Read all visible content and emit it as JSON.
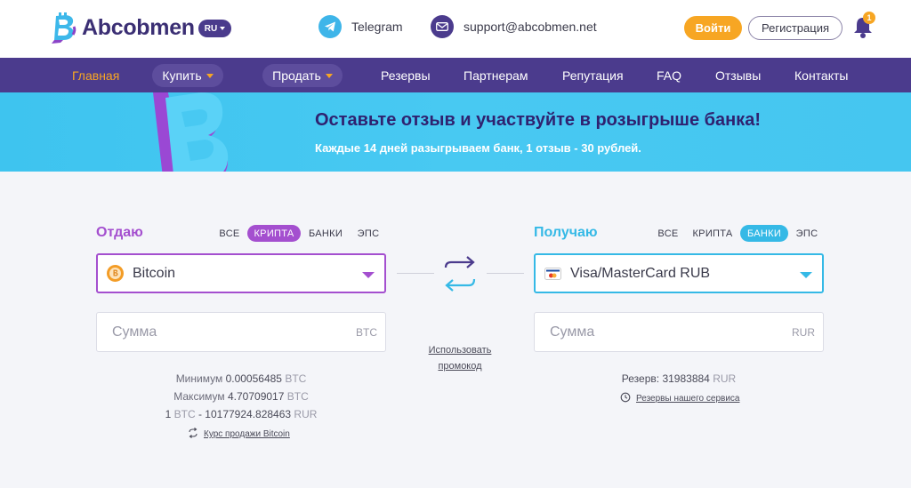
{
  "header": {
    "logo_text": "Abcobmen",
    "lang": "RU",
    "telegram_label": "Telegram",
    "support_email": "support@abcobmen.net",
    "login_label": "Войти",
    "register_label": "Регистрация",
    "notifications_count": "1"
  },
  "nav": {
    "items": [
      "Главная",
      "Купить",
      "Продать",
      "Резервы",
      "Партнерам",
      "Репутация",
      "FAQ",
      "Отзывы",
      "Контакты"
    ],
    "active": "Главная"
  },
  "banner": {
    "title": "Оставьте отзыв и участвуйте в розыгрыше банка!",
    "subtitle": "Каждые 14 дней разыгрываем банк, 1 отзыв - 30 рублей."
  },
  "give": {
    "label": "Отдаю",
    "filters": [
      "ВСЕ",
      "КРИПТА",
      "БАНКИ",
      "ЭПС"
    ],
    "active_filter": "КРИПТА",
    "selected": "Bitcoin",
    "amount_placeholder": "Сумма",
    "currency": "BTC",
    "min_label": "Минимум",
    "min_value": "0.00056485",
    "max_label": "Максимум",
    "max_value": "4.70709017",
    "rate_prefix": "1",
    "rate_cur_from": "BTC",
    "rate_sep": "-",
    "rate_value": "10177924.828463",
    "rate_cur_to": "RUR",
    "rate_link": "Курс продажи Bitcoin"
  },
  "receive": {
    "label": "Получаю",
    "filters": [
      "ВСЕ",
      "КРИПТА",
      "БАНКИ",
      "ЭПС"
    ],
    "active_filter": "БАНКИ",
    "selected": "Visa/MasterCard RUB",
    "amount_placeholder": "Сумма",
    "currency": "RUR",
    "reserve_label": "Резерв:",
    "reserve_value": "31983884",
    "reserve_cur": "RUR",
    "reserve_link": "Резервы нашего сервиса"
  },
  "promo_line1": "Использовать",
  "promo_line2": "промокод",
  "colors": {
    "brand_purple": "#4b3b8d",
    "accent_orange": "#f7a623",
    "give_purple": "#a44fcf",
    "receive_blue": "#35b9e6",
    "banner_cyan": "#45c6f0"
  }
}
